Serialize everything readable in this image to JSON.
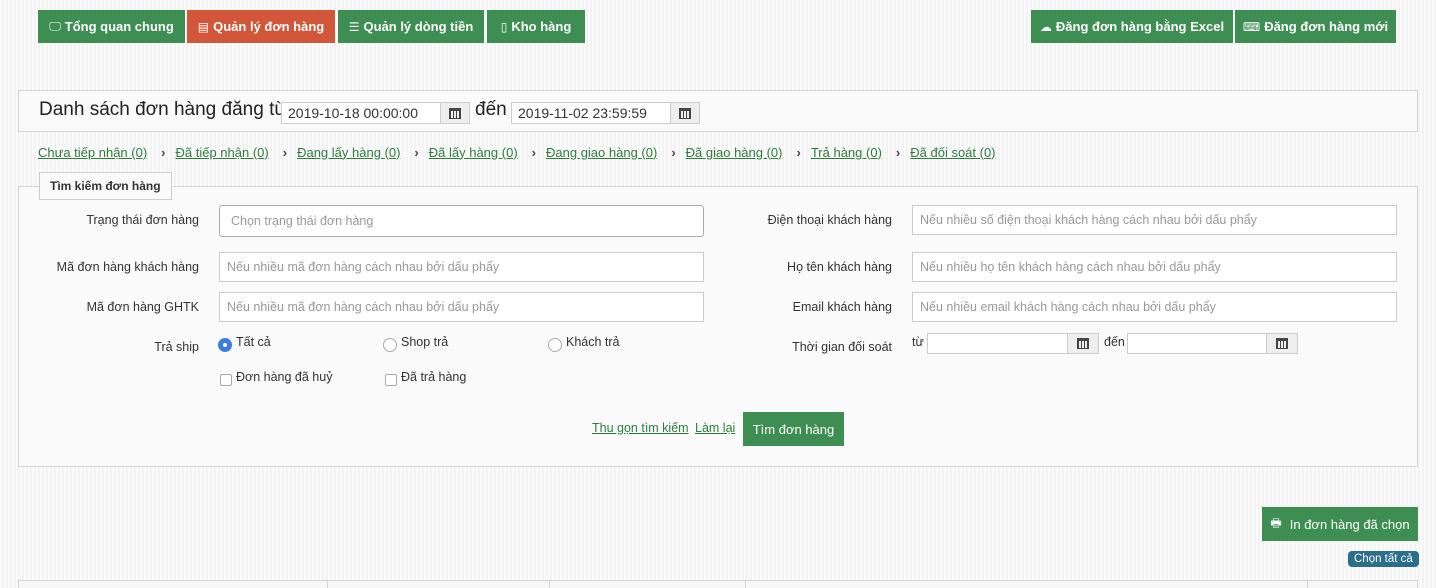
{
  "nav": {
    "overview": "Tổng quan chung",
    "orders": "Quản lý đơn hàng",
    "cashflow": "Quản lý dòng tiền",
    "warehouse": "Kho hàng",
    "upload_excel": "Đăng đơn hàng bằng Excel",
    "new_order": "Đăng đơn hàng mới"
  },
  "title": {
    "prefix": "Danh sách đơn hàng đăng từ",
    "from_date": "2019-10-18 00:00:00",
    "to_label": "đến",
    "to_date": "2019-11-02 23:59:59"
  },
  "status_tabs": [
    "Chưa tiếp nhận (0)",
    "Đã tiếp nhận (0)",
    "Đang lấy hàng (0)",
    "Đã lấy hàng (0)",
    "Đang giao hàng (0)",
    "Đã giao hàng (0)",
    "Trả hàng (0)",
    "Đã đối soát (0)"
  ],
  "search": {
    "legend": "Tìm kiếm đơn hàng",
    "status_label": "Trạng thái đơn hàng",
    "status_placeholder": "Chọn trạng thái đơn hàng",
    "customer_code_label": "Mã đơn hàng khách hàng",
    "customer_code_placeholder": "Nếu nhiều mã đơn hàng cách nhau bởi dấu phẩy",
    "ghtk_code_label": "Mã đơn hàng GHTK",
    "ghtk_code_placeholder": "Nếu nhiều mã đơn hàng cách nhau bởi dấu phẩy",
    "ship_label": "Trả ship",
    "ship_all": "Tất cả",
    "ship_shop": "Shop trả",
    "ship_customer": "Khách trả",
    "ship_selected": "Tất cả",
    "cancelled_label": "Đơn hàng đã huỷ",
    "returned_label": "Đã trả hàng",
    "phone_label": "Điện thoại khách hàng",
    "phone_placeholder": "Nếu nhiều số điện thoại khách hàng cách nhau bởi dấu phẩy",
    "name_label": "Họ tên khách hàng",
    "name_placeholder": "Nếu nhiều họ tên khách hàng cách nhau bởi dấu phẩy",
    "email_label": "Email khách hàng",
    "email_placeholder": "Nếu nhiều email khách hàng cách nhau bởi dấu phẩy",
    "reconcile_label": "Thời gian đối soát",
    "from_label": "từ",
    "to_label": "đến",
    "collapse": "Thu gọn tìm kiếm",
    "reset": "Làm lại",
    "submit": "Tìm đơn hàng"
  },
  "actions": {
    "print_selected": "In đơn hàng đã chọn",
    "select_all": "Chọn tất cả"
  }
}
